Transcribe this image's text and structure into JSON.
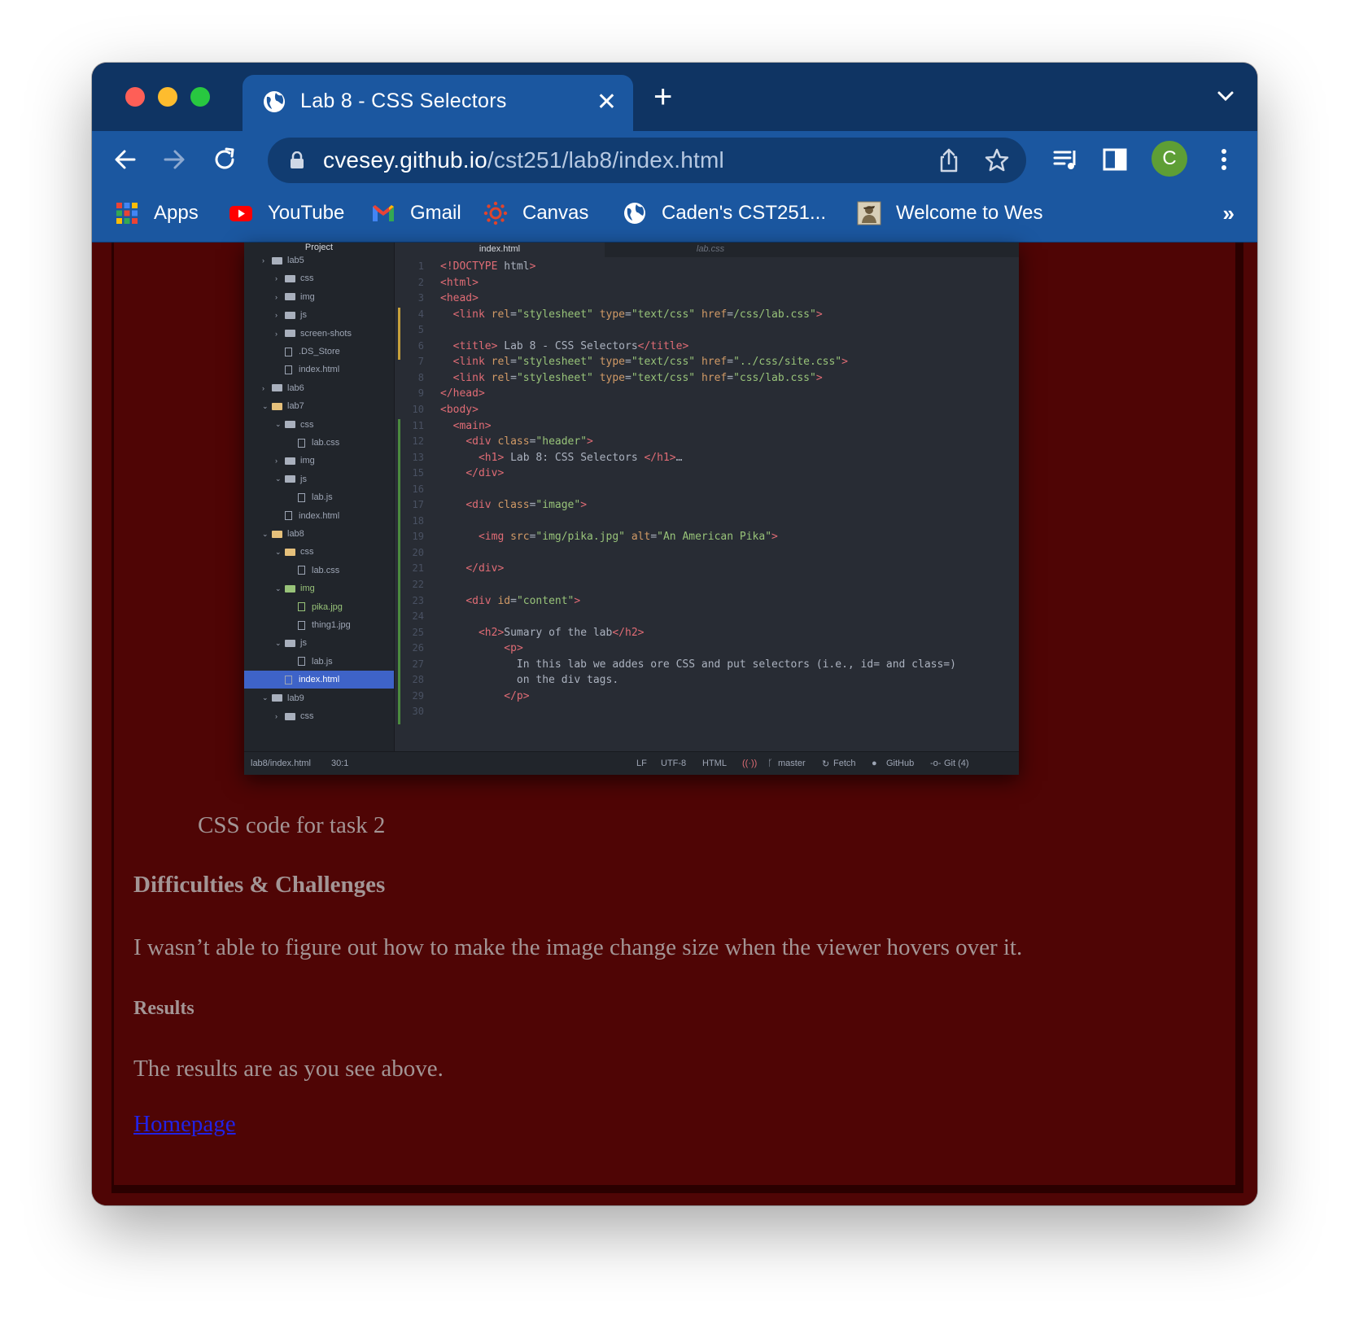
{
  "browser": {
    "tab_title": "Lab 8 - CSS Selectors",
    "url_host": "cvesey.github.io",
    "url_path": "/cst251/lab8/index.html",
    "avatar_letter": "C",
    "bookmarks": [
      {
        "label": "Apps",
        "icon": "apps-grid-icon"
      },
      {
        "label": "YouTube",
        "icon": "youtube-icon"
      },
      {
        "label": "Gmail",
        "icon": "gmail-icon"
      },
      {
        "label": "Canvas",
        "icon": "canvas-icon"
      },
      {
        "label": "Caden's CST251...",
        "icon": "globe-icon"
      },
      {
        "label": "Welcome to Wes",
        "icon": "site-thumbnail-icon"
      }
    ],
    "more_bookmarks": "»"
  },
  "editor": {
    "tree_header": "Project",
    "tree": [
      {
        "label": "lab5",
        "type": "folder",
        "depth": 1
      },
      {
        "label": "css",
        "type": "folder",
        "depth": 2
      },
      {
        "label": "img",
        "type": "folder",
        "depth": 2
      },
      {
        "label": "js",
        "type": "folder",
        "depth": 2
      },
      {
        "label": "screen-shots",
        "type": "folder",
        "depth": 2
      },
      {
        "label": ".DS_Store",
        "type": "file",
        "depth": 2
      },
      {
        "label": "index.html",
        "type": "file",
        "depth": 2
      },
      {
        "label": "lab6",
        "type": "folder",
        "depth": 1
      },
      {
        "label": "lab7",
        "type": "folder-open",
        "depth": 1
      },
      {
        "label": "css",
        "type": "folder",
        "depth": 2
      },
      {
        "label": "lab.css",
        "type": "file",
        "depth": 3
      },
      {
        "label": "img",
        "type": "folder",
        "depth": 2
      },
      {
        "label": "js",
        "type": "folder",
        "depth": 2
      },
      {
        "label": "lab.js",
        "type": "file",
        "depth": 3
      },
      {
        "label": "index.html",
        "type": "file",
        "depth": 2
      },
      {
        "label": "lab8",
        "type": "folder-open",
        "depth": 1
      },
      {
        "label": "css",
        "type": "folder-open",
        "depth": 2
      },
      {
        "label": "lab.css",
        "type": "file",
        "depth": 3
      },
      {
        "label": "img",
        "type": "folder-green",
        "depth": 2
      },
      {
        "label": "pika.jpg",
        "type": "file-green",
        "depth": 3
      },
      {
        "label": "thing1.jpg",
        "type": "file",
        "depth": 3
      },
      {
        "label": "js",
        "type": "folder",
        "depth": 2
      },
      {
        "label": "lab.js",
        "type": "file",
        "depth": 3
      },
      {
        "label": "index.html",
        "type": "file-selected",
        "depth": 2
      },
      {
        "label": "lab9",
        "type": "folder",
        "depth": 1
      },
      {
        "label": "css",
        "type": "folder",
        "depth": 2
      }
    ],
    "tabs": [
      "index.html",
      "lab.css"
    ],
    "line_numbers": [
      "1",
      "2",
      "3",
      "4",
      "5",
      "6",
      "7",
      "8",
      "9",
      "10",
      "11",
      "12",
      "13",
      "15",
      "16",
      "17",
      "18",
      "19",
      "20",
      "21",
      "22",
      "23",
      "24",
      "25",
      "26",
      "27",
      "28",
      "29",
      "30"
    ],
    "code_lines": [
      "<!DOCTYPE html>",
      "<html>",
      "<head>",
      "  <link rel=\"stylesheet\" type=\"text/css\" href=/css/lab.css\">",
      "",
      "  <title> Lab 8 - CSS Selectors</title>",
      "  <link rel=\"stylesheet\" type=\"text/css\" href=\"../css/site.css\">",
      "  <link rel=\"stylesheet\" type=\"text/css\" href=\"css/lab.css\">",
      "</head>",
      "<body>",
      "  <main>",
      "    <div class=\"header\">",
      "      <h1> Lab 8: CSS Selectors </h1>…",
      "    </div>",
      "",
      "    <div class=\"image\">",
      "",
      "      <img src=\"img/pika.jpg\" alt=\"An American Pika\">",
      "",
      "    </div>",
      "",
      "    <div id=\"content\">",
      "",
      "      <h2>Sumary of the lab</h2>",
      "          <p>",
      "            In this lab we addes ore CSS and put selectors (i.e., id= and class=)",
      "            on the div tags.",
      "          </p>",
      ""
    ],
    "status": {
      "file": "lab8/index.html",
      "cursor": "30:1",
      "line_ending": "LF",
      "encoding": "UTF-8",
      "grammar": "HTML",
      "branch": "master",
      "fetch": "Fetch",
      "github": "GitHub",
      "git": "Git (4)"
    }
  },
  "content": {
    "caption": "CSS code for task 2",
    "difficulties_heading": "Difficulties & Challenges",
    "difficulties_text": "I wasn’t able to figure out how to make the image change size when the viewer hovers over it.",
    "results_heading": "Results",
    "results_text": "The results are as you see above.",
    "homepage_link": "Homepage"
  },
  "colors": {
    "tab_strip": "#0f3463",
    "toolbar": "#1b57a0",
    "page_background": "#4f0505",
    "body_text": "#a39595",
    "link": "#2222e6"
  }
}
